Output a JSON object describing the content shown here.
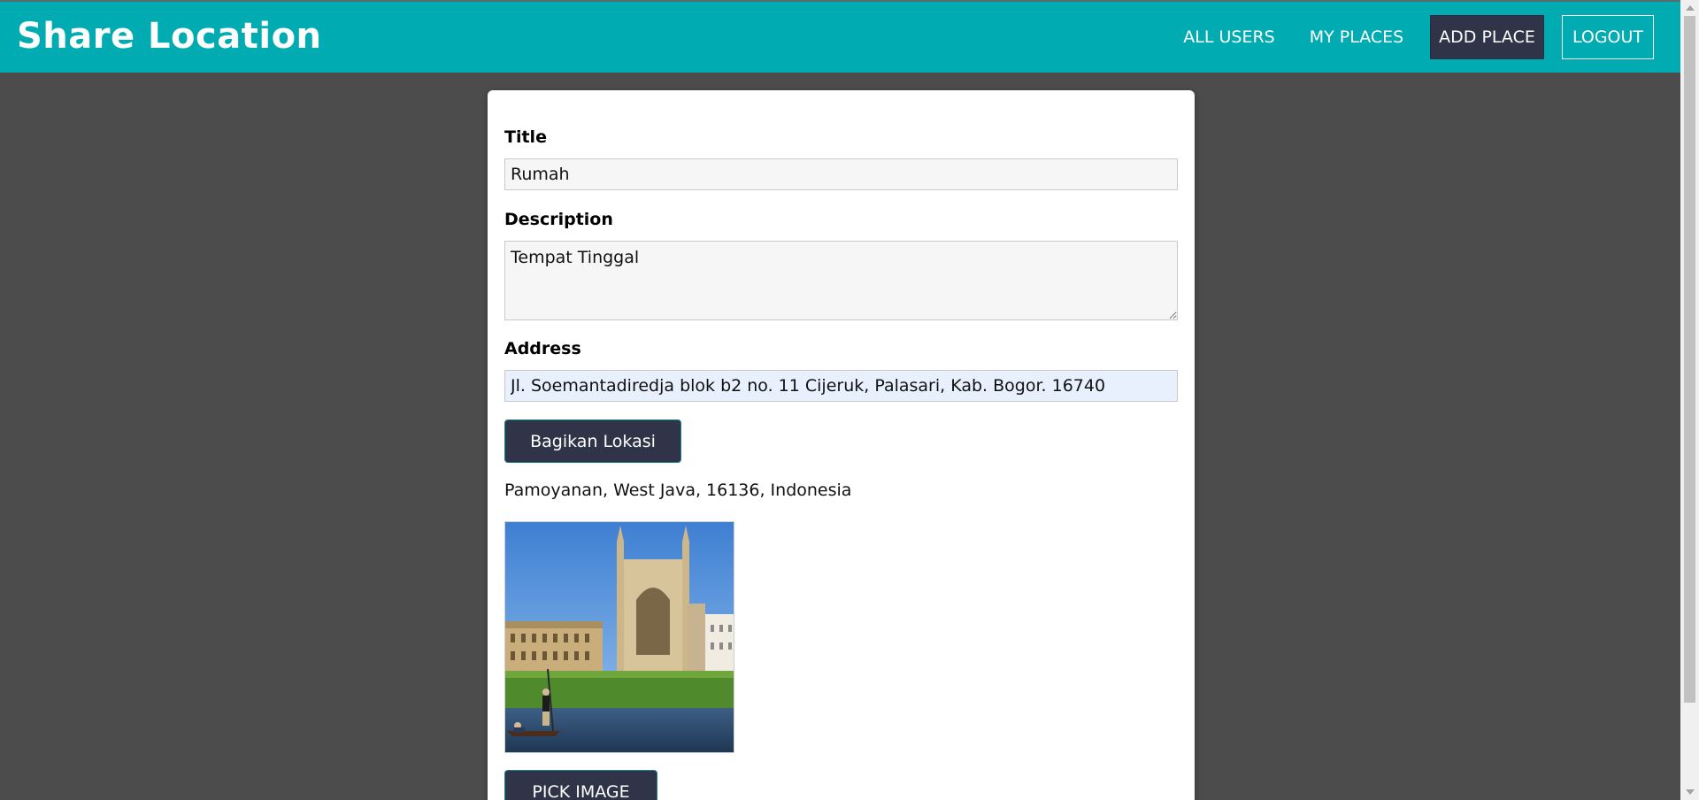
{
  "app": {
    "title": "Share Location"
  },
  "nav": {
    "all_users": "ALL USERS",
    "my_places": "MY PLACES",
    "add_place": "ADD PLACE",
    "logout": "LOGOUT"
  },
  "form": {
    "title_label": "Title",
    "title_value": "Rumah",
    "description_label": "Description",
    "description_value": "Tempat Tinggal",
    "address_label": "Address",
    "address_value": "Jl. Soemantadiredja blok b2 no. 11 Cijeruk, Palasari, Kab. Bogor. 16740",
    "share_button": "Bagikan Lokasi",
    "resolved_location": "Pamoyanan, West Java, 16136, Indonesia",
    "pick_image_button": "PICK IMAGE"
  },
  "colors": {
    "header": "#00acb1",
    "background": "#4c4c4c",
    "button": "#2f3448",
    "active_nav": "#2f3448"
  },
  "icons": {
    "scroll_up": "chevron-up-icon",
    "scroll_down": "chevron-down-icon"
  }
}
